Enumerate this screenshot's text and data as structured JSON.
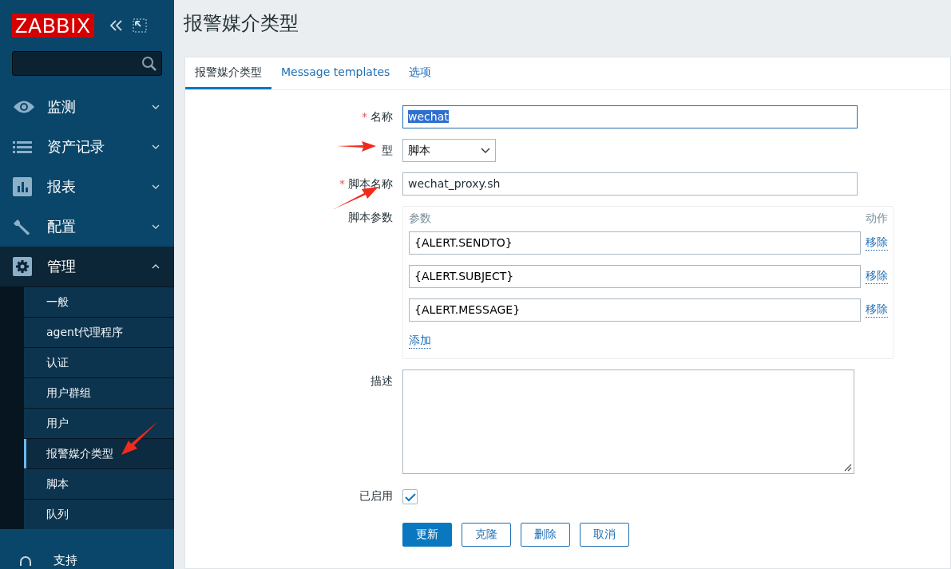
{
  "logo": "ZABBIX",
  "sidebar": {
    "menu": [
      {
        "label": "监测",
        "expanded": false
      },
      {
        "label": "资产记录",
        "expanded": false
      },
      {
        "label": "报表",
        "expanded": false
      },
      {
        "label": "配置",
        "expanded": false
      },
      {
        "label": "管理",
        "expanded": true,
        "children": [
          {
            "label": "一般",
            "selected": false
          },
          {
            "label": "agent代理程序",
            "selected": false
          },
          {
            "label": "认证",
            "selected": false
          },
          {
            "label": "用户群组",
            "selected": false
          },
          {
            "label": "用户",
            "selected": false
          },
          {
            "label": "报警媒介类型",
            "selected": true
          },
          {
            "label": "脚本",
            "selected": false
          },
          {
            "label": "队列",
            "selected": false
          }
        ]
      }
    ],
    "support": "支持"
  },
  "page_title": "报警媒介类型",
  "tabs": [
    {
      "label": "报警媒介类型",
      "selected": true
    },
    {
      "label": "Message templates",
      "selected": false
    },
    {
      "label": "选项",
      "selected": false
    }
  ],
  "form": {
    "name": {
      "label": "名称",
      "required_mark": "*",
      "value": "wechat"
    },
    "type": {
      "label": "型",
      "value": "脚本"
    },
    "script_name": {
      "label": "脚本名称",
      "required_mark": "*",
      "value": "wechat_proxy.sh"
    },
    "script_params": {
      "label": "脚本参数",
      "column_1": "参数",
      "column_2": "动作",
      "rows": [
        {
          "value": "{ALERT.SENDTO}",
          "action": "移除"
        },
        {
          "value": "{ALERT.SUBJECT}",
          "action": "移除"
        },
        {
          "value": "{ALERT.MESSAGE}",
          "action": "移除"
        }
      ],
      "add": "添加"
    },
    "description": {
      "label": "描述"
    },
    "enabled": {
      "label": "已启用",
      "checked": true
    },
    "buttons": [
      {
        "label": "更新",
        "kind": "primary"
      },
      {
        "label": "克隆",
        "kind": "secondary"
      },
      {
        "label": "删除",
        "kind": "secondary"
      },
      {
        "label": "取消",
        "kind": "secondary"
      }
    ]
  }
}
